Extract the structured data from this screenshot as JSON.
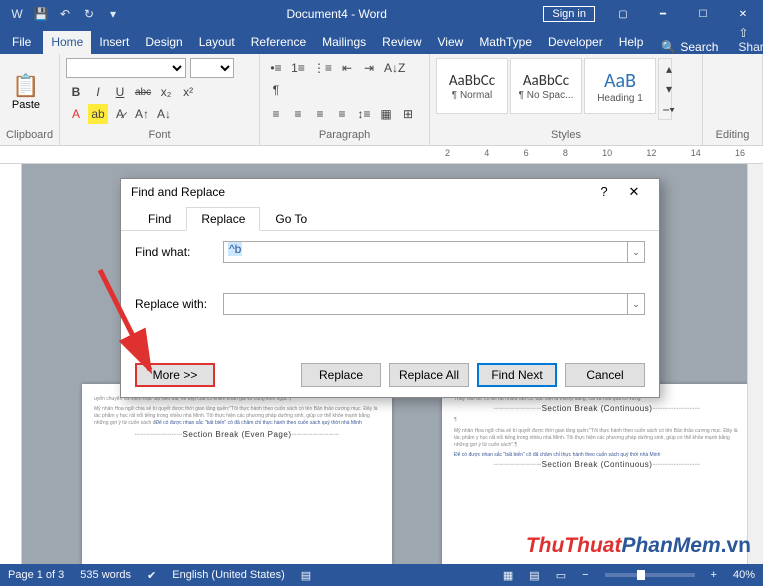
{
  "titlebar": {
    "title": "Document4 - Word",
    "signin": "Sign in",
    "qat_icons": [
      "save-icon",
      "undo-icon",
      "redo-icon",
      "dropdown-icon"
    ]
  },
  "tabs": {
    "items": [
      "File",
      "Home",
      "Insert",
      "Design",
      "Layout",
      "Reference",
      "Mailings",
      "Review",
      "View",
      "MathType",
      "Developer",
      "Help"
    ],
    "active": "Home",
    "search": "Search",
    "share": "Share"
  },
  "ribbon": {
    "clipboard": {
      "label": "Clipboard",
      "paste": "Paste"
    },
    "font": {
      "label": "Font",
      "bold": "B",
      "italic": "I",
      "underline": "U",
      "strike": "abc",
      "sub": "x₂",
      "sup": "x²"
    },
    "paragraph": {
      "label": "Paragraph"
    },
    "styles": {
      "label": "Styles",
      "items": [
        {
          "sample": "AaBbCc",
          "name": "¶ Normal"
        },
        {
          "sample": "AaBbCc",
          "name": "¶ No Spac..."
        },
        {
          "sample": "AaB",
          "name": "Heading 1"
        }
      ]
    },
    "editing": {
      "label": "Editing"
    }
  },
  "ruler": {
    "marks": [
      "2",
      "4",
      "6",
      "8",
      "10",
      "12",
      "14",
      "16"
    ]
  },
  "dialog": {
    "title": "Find and Replace",
    "tabs": {
      "find": "Find",
      "replace": "Replace",
      "goto": "Go To"
    },
    "find_label": "Find what:",
    "find_value": "^b",
    "replace_label": "Replace with:",
    "replace_value": "",
    "buttons": {
      "more": "More >>",
      "replace": "Replace",
      "replace_all": "Replace All",
      "find_next": "Find Next",
      "cancel": "Cancel"
    }
  },
  "document": {
    "section_break_even": "Section Break (Even Page)",
    "section_break_cont": "Section Break (Continuous)"
  },
  "statusbar": {
    "page": "Page 1 of 3",
    "words": "535 words",
    "language": "English (United States)",
    "zoom": "40%"
  },
  "watermark": {
    "a": "ThuThuat",
    "b": "PhanMem",
    "c": ".vn"
  }
}
